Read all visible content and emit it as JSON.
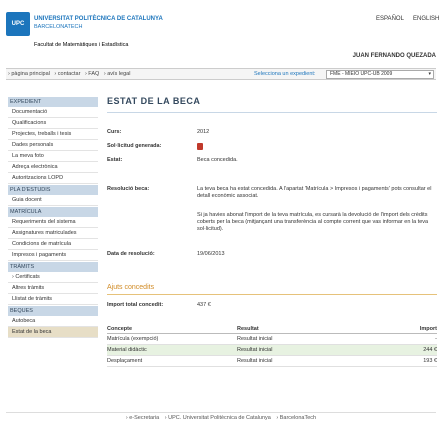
{
  "header": {
    "logo_text": "UPC",
    "university_name": "UNIVERSITAT POLITÈCNICA DE CATALUNYA",
    "university_sub": "BARCELONATECH",
    "faculty": "Facultat de Matemàtiques i Estadística",
    "lang_es": "ESPAÑOL",
    "lang_en": "ENGLISH",
    "user_name": "JUAN FERNANDO QUEZADA"
  },
  "nav": {
    "links": [
      "› pàgina principal",
      "› contactar",
      "› FAQ",
      "› avís legal"
    ],
    "expedient_label": "Selecciona un expedient:",
    "expedient_value": "FME - MIEIO UPC-UB 2009"
  },
  "sidebar": {
    "sections": [
      {
        "title": "EXPEDIENT",
        "items": [
          "Documentació",
          "Qualificacions",
          "Projectes, treballs i tesis",
          "Dades personals",
          "La meva foto",
          "Adreça electrònica",
          "Autoritzacions LOPD"
        ]
      },
      {
        "title": "PLA D'ESTUDIS",
        "items": [
          "Guia docent"
        ]
      },
      {
        "title": "MATRÍCULA",
        "items": [
          "Requeriments del sistema",
          "Assignatures matriculades",
          "Condicions de matrícula",
          "Impresos i pagaments"
        ]
      },
      {
        "title": "TRÀMITS",
        "items": [
          "› Certificats",
          "Altres tràmits",
          "Llistat de tràmits"
        ]
      },
      {
        "title": "BEQUES",
        "items": [
          "Autobeca",
          "Estat de la beca"
        ]
      }
    ]
  },
  "main": {
    "title": "ESTAT DE LA BECA",
    "curs_label": "Curs:",
    "curs_value": "2012",
    "sollicitud_label": "Sol·licitud generada:",
    "estat_label": "Estat:",
    "estat_value": "Beca concedida.",
    "resolucio_label": "Resolució beca:",
    "resolucio_p1": "La teva beca ha estat concedida. A l'apartat 'Matrícula > Impresos i pagaments' pots consultar el detall econòmic associat.",
    "resolucio_p2": "Si ja havies abonat l'import de la teva matrícula, es cursarà la devolució de l'import dels crèdits coberts per la beca (mitjançant una transferència al compte corrent que vas informar en la teva sol·licitud).",
    "data_label": "Data de resolució:",
    "data_value": "19/06/2013",
    "ajuts_title": "Ajuts concedits",
    "import_label": "Import total concedit:",
    "import_value": "437 €",
    "table": {
      "headers": [
        "Concepte",
        "Resultat",
        "Import"
      ],
      "rows": [
        [
          "Matrícula (exempció)",
          "Resultat inicial",
          "-"
        ],
        [
          "Material didàctic",
          "Resultat inicial",
          "244 €"
        ],
        [
          "Desplaçament",
          "Resultat inicial",
          "193 €"
        ]
      ]
    }
  },
  "footer": {
    "items": [
      "› e-Secretaria",
      "› UPC. Universitat Politècnica de Catalunya",
      "› BarcelonaTech"
    ]
  }
}
